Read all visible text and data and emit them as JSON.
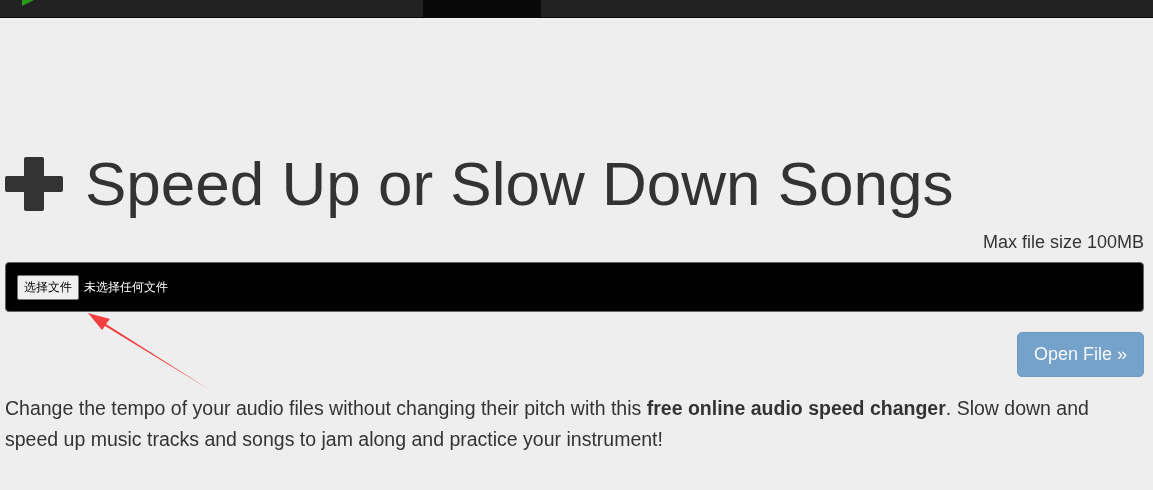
{
  "title": "Speed Up or Slow Down Songs",
  "max_size": "Max file size 100MB",
  "file_input": {
    "button": "选择文件",
    "status": "未选择任何文件"
  },
  "open_button": {
    "label": "Open File »",
    "disabled": true
  },
  "description": "Change the tempo of your audio files without changing their pitch with this **free online audio speed changer**. Slow down and speed up music tracks and songs to jam along and practice your instrument!"
}
